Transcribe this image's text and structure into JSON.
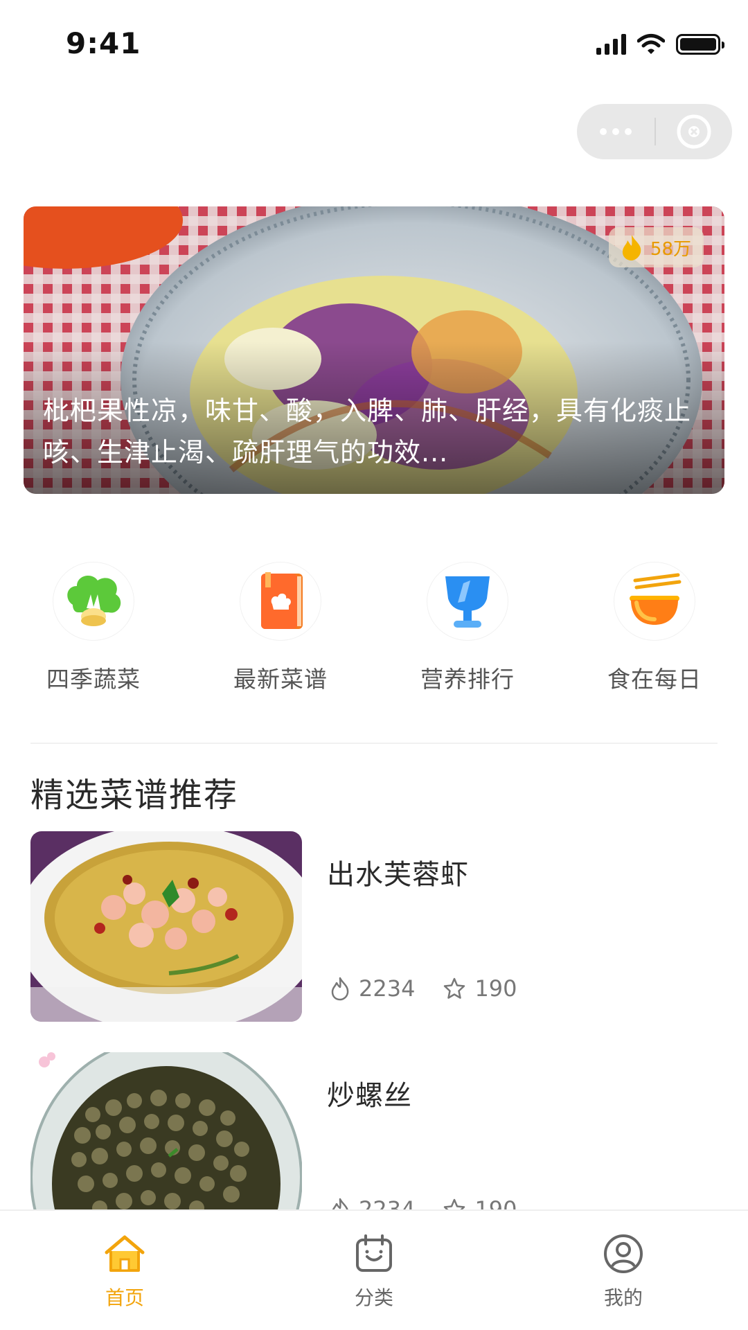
{
  "status_bar": {
    "time": "9:41"
  },
  "banner": {
    "hot_count": "58万",
    "text": "枇杷果性凉，味甘、酸，入脾、肺、肝经，具有化痰止咳、生津止渴、疏肝理气的功效..."
  },
  "quick_menu": [
    {
      "label": "四季蔬菜",
      "icon": "vegetable-icon"
    },
    {
      "label": "最新菜谱",
      "icon": "recipe-book-icon"
    },
    {
      "label": "营养排行",
      "icon": "trophy-icon"
    },
    {
      "label": "食在每日",
      "icon": "noodle-bowl-icon"
    }
  ],
  "section_title": "精选菜谱推荐",
  "recipes": [
    {
      "name": "出水芙蓉虾",
      "views": "2234",
      "favorites": "190"
    },
    {
      "name": "炒螺丝",
      "views": "2234",
      "favorites": "190"
    }
  ],
  "tabs": [
    {
      "label": "首页",
      "icon": "home-icon",
      "active": true
    },
    {
      "label": "分类",
      "icon": "category-icon",
      "active": false
    },
    {
      "label": "我的",
      "icon": "profile-icon",
      "active": false
    }
  ],
  "colors": {
    "accent": "#F2A40C",
    "text_primary": "#2A2A2A",
    "text_secondary": "#777777"
  }
}
